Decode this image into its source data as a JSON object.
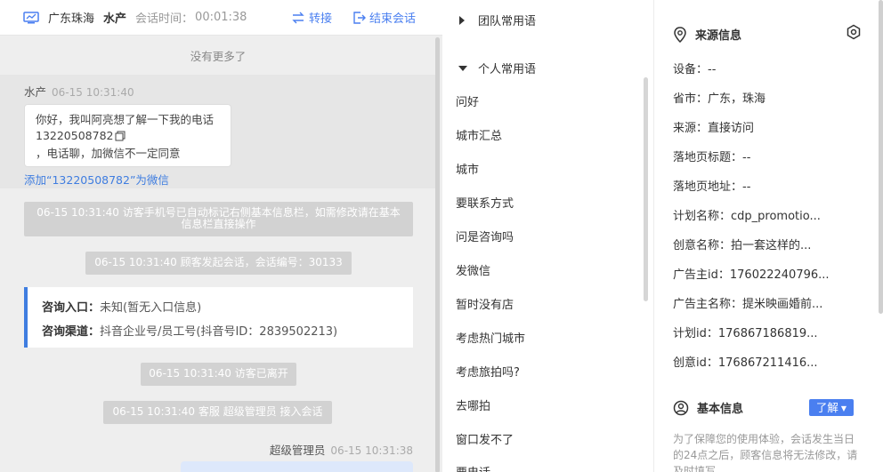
{
  "header": {
    "location": "广东珠海",
    "customer_name": "水产",
    "session_time_label": "会话时间：",
    "session_time_value": "00:01:38",
    "transfer_label": "转接",
    "end_session_label": "结束会话"
  },
  "chat": {
    "no_more": "没有更多了",
    "customer_message": {
      "sender": "水产",
      "timestamp": "06-15 10:31:40",
      "line1": "你好，我叫阿亮想了解一下我的电话",
      "phone": "13220508782",
      "line3": "，电话聊，加微信不一定同意"
    },
    "add_wechat_link": "添加“13220508782”为微信",
    "system_messages": [
      "06-15 10:31:40 访客手机号已自动标记右侧基本信息栏，如需修改请在基本信息栏直接操作",
      "06-15 10:31:40 顾客发起会话，会话编号：30133",
      "06-15 10:31:40 访客已离开",
      "06-15 10:31:40 客服 超级管理员 接入会话"
    ],
    "consult_card": {
      "entry_label": "咨询入口：",
      "entry_value": "未知(暂无入口信息)",
      "channel_label": "咨询渠道：",
      "channel_value": "抖音企业号/员工号(抖音号ID：2839502213)"
    },
    "agent_message": {
      "sender": "超级管理员",
      "timestamp": "06-15 10:31:38"
    }
  },
  "phrases": {
    "team_group": "团队常用语",
    "personal_group": "个人常用语",
    "items": [
      "问好",
      "城市汇总",
      "城市",
      "要联系方式",
      "问是咨询吗",
      "发微信",
      "暂时没有店",
      "考虑热门城市",
      "考虑旅拍吗?",
      "去哪拍",
      "窗口发不了",
      "要电话"
    ]
  },
  "source_info": {
    "title": "来源信息",
    "fields": [
      {
        "label": "设备：",
        "value": "--"
      },
      {
        "label": "省市：",
        "value": "广东，珠海"
      },
      {
        "label": "来源：",
        "value": "直接访问"
      },
      {
        "label": "落地页标题：",
        "value": "--"
      },
      {
        "label": "落地页地址：",
        "value": "--"
      },
      {
        "label": "计划名称：",
        "value": "cdp_promotio..."
      },
      {
        "label": "创意名称：",
        "value": "拍一套这样的..."
      },
      {
        "label": "广告主id：",
        "value": "176022240796..."
      },
      {
        "label": "广告主名称：",
        "value": "提米映画婚前..."
      },
      {
        "label": "计划id：",
        "value": "176867186819..."
      },
      {
        "label": "创意id：",
        "value": "176867211416..."
      }
    ]
  },
  "basic_info": {
    "title": "基本信息",
    "learn_more": "了解",
    "notice": "为了保障您的使用体验，会话发生当日的24点之后，顾客信息将无法修改，请及时填写"
  },
  "colors": {
    "accent": "#4a7ff0",
    "link": "#3f7de0",
    "system_msg_bg": "#d2d2d2",
    "chat_bg": "#eeeeee"
  }
}
